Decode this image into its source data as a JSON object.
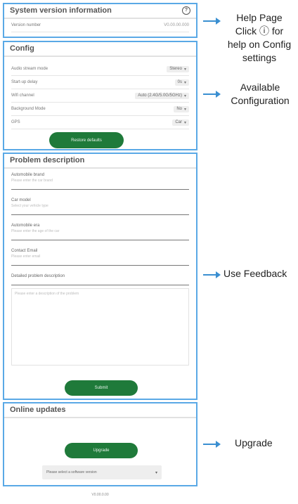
{
  "system": {
    "title": "System version information",
    "help_icon": "help-circle-icon",
    "version_label": "Version number",
    "version_value": "V0.00.00.000"
  },
  "config": {
    "title": "Config",
    "rows": [
      {
        "label": "Audio stream mode",
        "value": "Stereo"
      },
      {
        "label": "Start-up delay",
        "value": "0s"
      },
      {
        "label": "Wifi channel",
        "value": "Auto (2.4G/5.0G/5GHz)"
      },
      {
        "label": "Background Mode",
        "value": "No"
      },
      {
        "label": "GPS",
        "value": "Car"
      }
    ],
    "button": "Restore defaults"
  },
  "problem": {
    "title": "Problem description",
    "fields": [
      {
        "label": "Automobile brand",
        "placeholder": "Please enter the car brand"
      },
      {
        "label": "Car model",
        "placeholder": "Select your vehicle type"
      },
      {
        "label": "Automobile era",
        "placeholder": "Please enter the age of the car"
      },
      {
        "label": "Contact Email",
        "placeholder": "Please enter email"
      }
    ],
    "detail_label": "Detailed problem description",
    "detail_placeholder": "Please enter a description of the problem",
    "submit": "Submit"
  },
  "online": {
    "title": "Online updates",
    "button": "Upgrade",
    "select_placeholder": "Please select a software version"
  },
  "footer_version": "V0.00.0.00",
  "annotations": {
    "help": [
      "Help Page",
      "Click ⓘ for",
      "help on Config",
      "settings"
    ],
    "available": [
      "Available",
      "Configuration"
    ],
    "feedback": "Use Feedback",
    "upgrade": "Upgrade"
  }
}
